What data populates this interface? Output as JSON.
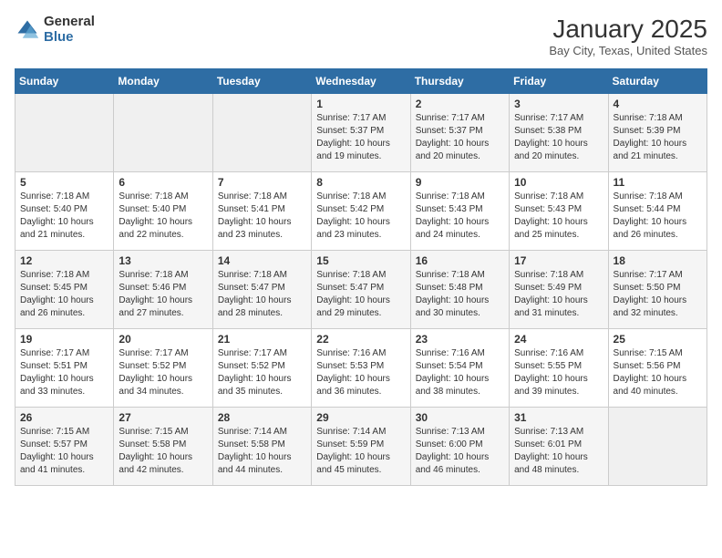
{
  "header": {
    "logo_general": "General",
    "logo_blue": "Blue",
    "title": "January 2025",
    "subtitle": "Bay City, Texas, United States"
  },
  "days_of_week": [
    "Sunday",
    "Monday",
    "Tuesday",
    "Wednesday",
    "Thursday",
    "Friday",
    "Saturday"
  ],
  "weeks": [
    [
      {
        "day": "",
        "info": ""
      },
      {
        "day": "",
        "info": ""
      },
      {
        "day": "",
        "info": ""
      },
      {
        "day": "1",
        "info": "Sunrise: 7:17 AM\nSunset: 5:37 PM\nDaylight: 10 hours\nand 19 minutes."
      },
      {
        "day": "2",
        "info": "Sunrise: 7:17 AM\nSunset: 5:37 PM\nDaylight: 10 hours\nand 20 minutes."
      },
      {
        "day": "3",
        "info": "Sunrise: 7:17 AM\nSunset: 5:38 PM\nDaylight: 10 hours\nand 20 minutes."
      },
      {
        "day": "4",
        "info": "Sunrise: 7:18 AM\nSunset: 5:39 PM\nDaylight: 10 hours\nand 21 minutes."
      }
    ],
    [
      {
        "day": "5",
        "info": "Sunrise: 7:18 AM\nSunset: 5:40 PM\nDaylight: 10 hours\nand 21 minutes."
      },
      {
        "day": "6",
        "info": "Sunrise: 7:18 AM\nSunset: 5:40 PM\nDaylight: 10 hours\nand 22 minutes."
      },
      {
        "day": "7",
        "info": "Sunrise: 7:18 AM\nSunset: 5:41 PM\nDaylight: 10 hours\nand 23 minutes."
      },
      {
        "day": "8",
        "info": "Sunrise: 7:18 AM\nSunset: 5:42 PM\nDaylight: 10 hours\nand 23 minutes."
      },
      {
        "day": "9",
        "info": "Sunrise: 7:18 AM\nSunset: 5:43 PM\nDaylight: 10 hours\nand 24 minutes."
      },
      {
        "day": "10",
        "info": "Sunrise: 7:18 AM\nSunset: 5:43 PM\nDaylight: 10 hours\nand 25 minutes."
      },
      {
        "day": "11",
        "info": "Sunrise: 7:18 AM\nSunset: 5:44 PM\nDaylight: 10 hours\nand 26 minutes."
      }
    ],
    [
      {
        "day": "12",
        "info": "Sunrise: 7:18 AM\nSunset: 5:45 PM\nDaylight: 10 hours\nand 26 minutes."
      },
      {
        "day": "13",
        "info": "Sunrise: 7:18 AM\nSunset: 5:46 PM\nDaylight: 10 hours\nand 27 minutes."
      },
      {
        "day": "14",
        "info": "Sunrise: 7:18 AM\nSunset: 5:47 PM\nDaylight: 10 hours\nand 28 minutes."
      },
      {
        "day": "15",
        "info": "Sunrise: 7:18 AM\nSunset: 5:47 PM\nDaylight: 10 hours\nand 29 minutes."
      },
      {
        "day": "16",
        "info": "Sunrise: 7:18 AM\nSunset: 5:48 PM\nDaylight: 10 hours\nand 30 minutes."
      },
      {
        "day": "17",
        "info": "Sunrise: 7:18 AM\nSunset: 5:49 PM\nDaylight: 10 hours\nand 31 minutes."
      },
      {
        "day": "18",
        "info": "Sunrise: 7:17 AM\nSunset: 5:50 PM\nDaylight: 10 hours\nand 32 minutes."
      }
    ],
    [
      {
        "day": "19",
        "info": "Sunrise: 7:17 AM\nSunset: 5:51 PM\nDaylight: 10 hours\nand 33 minutes."
      },
      {
        "day": "20",
        "info": "Sunrise: 7:17 AM\nSunset: 5:52 PM\nDaylight: 10 hours\nand 34 minutes."
      },
      {
        "day": "21",
        "info": "Sunrise: 7:17 AM\nSunset: 5:52 PM\nDaylight: 10 hours\nand 35 minutes."
      },
      {
        "day": "22",
        "info": "Sunrise: 7:16 AM\nSunset: 5:53 PM\nDaylight: 10 hours\nand 36 minutes."
      },
      {
        "day": "23",
        "info": "Sunrise: 7:16 AM\nSunset: 5:54 PM\nDaylight: 10 hours\nand 38 minutes."
      },
      {
        "day": "24",
        "info": "Sunrise: 7:16 AM\nSunset: 5:55 PM\nDaylight: 10 hours\nand 39 minutes."
      },
      {
        "day": "25",
        "info": "Sunrise: 7:15 AM\nSunset: 5:56 PM\nDaylight: 10 hours\nand 40 minutes."
      }
    ],
    [
      {
        "day": "26",
        "info": "Sunrise: 7:15 AM\nSunset: 5:57 PM\nDaylight: 10 hours\nand 41 minutes."
      },
      {
        "day": "27",
        "info": "Sunrise: 7:15 AM\nSunset: 5:58 PM\nDaylight: 10 hours\nand 42 minutes."
      },
      {
        "day": "28",
        "info": "Sunrise: 7:14 AM\nSunset: 5:58 PM\nDaylight: 10 hours\nand 44 minutes."
      },
      {
        "day": "29",
        "info": "Sunrise: 7:14 AM\nSunset: 5:59 PM\nDaylight: 10 hours\nand 45 minutes."
      },
      {
        "day": "30",
        "info": "Sunrise: 7:13 AM\nSunset: 6:00 PM\nDaylight: 10 hours\nand 46 minutes."
      },
      {
        "day": "31",
        "info": "Sunrise: 7:13 AM\nSunset: 6:01 PM\nDaylight: 10 hours\nand 48 minutes."
      },
      {
        "day": "",
        "info": ""
      }
    ]
  ]
}
